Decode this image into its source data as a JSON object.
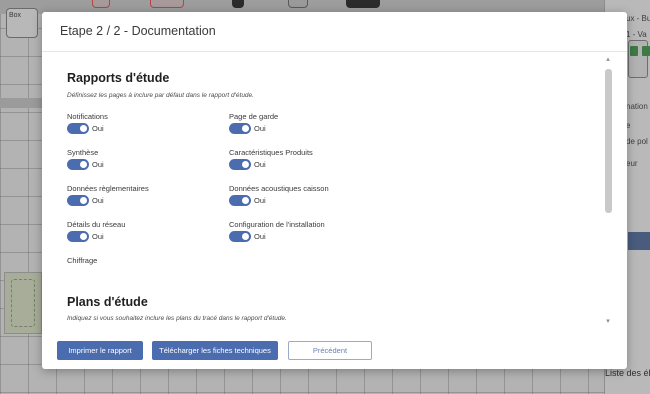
{
  "background": {
    "left_tab_text": "Box",
    "right_header_text": "ux - Bu",
    "right_sub_text": "1 - Va",
    "right_items": [
      "nation",
      "e",
      "de pol",
      "eur"
    ],
    "list_label": "Liste des élé"
  },
  "modal": {
    "title": "Etape 2 / 2 - Documentation",
    "toggle_on_text": "Oui",
    "rapports": {
      "title": "Rapports d'étude",
      "description": "Définissez les pages à inclure par défaut dans le rapport d'étude.",
      "options": [
        {
          "label": "Notifications",
          "value": "Oui"
        },
        {
          "label": "Page de garde",
          "value": "Oui"
        },
        {
          "label": "Synthèse",
          "value": "Oui"
        },
        {
          "label": "Caractéristiques Produits",
          "value": "Oui"
        },
        {
          "label": "Données règlementaires",
          "value": "Oui"
        },
        {
          "label": "Données acoustiques caisson",
          "value": "Oui"
        },
        {
          "label": "Détails du réseau",
          "value": "Oui"
        },
        {
          "label": "Configuration de l'installation",
          "value": "Oui"
        },
        {
          "label": "Chiffrage",
          "value": ""
        }
      ]
    },
    "plans": {
      "title": "Plans d'étude",
      "description": "Indiquez si vous souhaitez inclure les plans du tracé dans le rapport d'étude."
    },
    "footer": {
      "print_label": "Imprimer le rapport",
      "download_label": "Télécharger les fiches techniques",
      "previous_label": "Précédent"
    }
  },
  "colors": {
    "accent": "#4c6cb0",
    "overlay": "#a9a9a9"
  }
}
